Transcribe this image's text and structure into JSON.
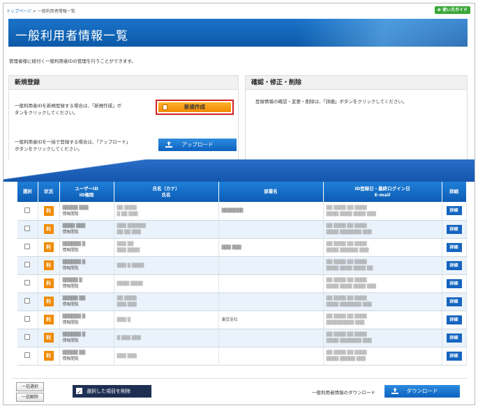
{
  "breadcrumb": {
    "home": "トップページ",
    "sep": " > ",
    "current": "一般利用者情報一覧"
  },
  "guide_button": "使い方ガイド",
  "page_title": "一般利用者情報一覧",
  "description": "管理者様に紐付く一般利用者IDの管理を行うことができます。",
  "register_panel": {
    "title": "新規登録",
    "text1_line1": "一般利用者IDを新規登録する場合は、「新規作成」ボ",
    "text1_line2": "タンをクリックしてください。",
    "new_button": "新規作成",
    "text2_line1": "一般利用者IDを一括で登録する場合は、「アップロード」",
    "text2_line2": "ボタンをクリックしてください。",
    "upload_button": "アップロード"
  },
  "edit_panel": {
    "title": "確認・修正・削除",
    "text": "登録情報の確認・変更・削除は、「詳細」ボタンをクリックしてください。"
  },
  "table": {
    "headers": {
      "select": "選択",
      "status": "状況",
      "user_id_1": "ユーザーID",
      "user_id_2": "ID権限",
      "name_1": "氏名（カナ）",
      "name_2": "氏名",
      "dept": "部署名",
      "date_1": "ID登録日・最終ログイン日",
      "date_2": "E-mail",
      "detail": "詳細"
    },
    "status_label": "利",
    "detail_label": "詳細",
    "rows": [
      {
        "uid": "▒▒▒▒▒ ▒▒▒",
        "role": "情報閲覧",
        "kana": "▒▒ ▒▒▒▒",
        "name": "▒ ▒▒ ▒▒▒",
        "dept": "▒▒▒▒▒▒▒",
        "date": "▒▒ ▒▒▒▒ ▒▒ ▒▒▒▒",
        "email": "▒▒▒▒ ▒▒▒▒ ▒▒▒▒ ▒▒▒"
      },
      {
        "uid": "▒▒▒▒ ▒▒▒",
        "role": "情報閲覧",
        "kana": "▒▒▒ ▒▒▒▒▒▒",
        "name": "▒▒ ▒▒ ▒▒▒",
        "dept": "",
        "date": "▒▒ ▒▒▒▒ ▒▒ ▒▒▒▒",
        "email": "▒▒▒▒ ▒▒▒▒▒▒▒ ▒▒▒"
      },
      {
        "uid": "▒▒▒▒▒▒ ▒",
        "role": "情報閲覧",
        "kana": "▒▒▒ ▒▒",
        "name": "▒▒▒ ▒▒▒▒",
        "dept": "▒▒▒ ▒▒▒",
        "date": "▒▒ ▒▒▒▒ ▒▒ ▒▒▒▒",
        "email": "▒▒▒▒ ▒▒▒▒▒▒ ▒▒▒"
      },
      {
        "uid": "▒▒▒▒▒▒ ▒",
        "role": "情報閲覧",
        "kana": "",
        "name": "▒▒▒ ▒ ▒▒▒▒",
        "dept": "",
        "date": "▒▒ ▒▒▒▒ ▒▒ ▒▒▒▒",
        "email": "▒▒▒▒ ▒▒▒▒ ▒▒▒▒ ▒▒"
      },
      {
        "uid": "▒▒▒▒▒ ▒",
        "role": "情報閲覧",
        "kana": "",
        "name": "▒▒▒▒ ▒▒▒▒",
        "dept": "",
        "date": "▒▒ ▒▒▒▒ ▒▒ ▒▒▒▒",
        "email": "▒▒▒▒ ▒▒▒▒ ▒▒▒▒ ▒▒▒"
      },
      {
        "uid": "▒▒▒▒▒ ▒▒",
        "role": "情報閲覧",
        "kana": "▒▒ ▒▒▒▒",
        "name": "▒▒▒ ▒▒▒",
        "dept": "",
        "date": "▒▒ ▒▒▒▒ ▒▒ ▒▒▒▒",
        "email": "▒▒▒▒ ▒▒▒▒▒▒▒ ▒▒▒"
      },
      {
        "uid": "▒▒▒▒▒▒ ▒",
        "role": "情報閲覧",
        "kana": "",
        "name": "▒▒▒ ▒",
        "dept": "東京支社",
        "date": "▒▒ ▒▒▒▒ ▒▒ ▒▒▒▒",
        "email": "▒▒▒▒▒▒▒▒▒ ▒▒▒"
      },
      {
        "uid": "▒▒▒▒▒▒ ▒",
        "role": "情報閲覧",
        "kana": "",
        "name": "▒ ▒▒▒ ▒▒▒",
        "dept": "",
        "date": "▒▒ ▒▒▒▒ ▒▒ ▒▒▒▒",
        "email": "▒▒▒▒ ▒▒▒▒▒▒▒ ▒▒▒"
      },
      {
        "uid": "▒▒▒▒▒ ▒▒",
        "role": "情報閲覧",
        "kana": "",
        "name": "▒▒▒ ▒▒▒",
        "dept": "",
        "date": "▒▒ ▒▒▒▒ ▒▒ ▒▒▒▒",
        "email": "▒▒▒▒ ▒▒▒▒▒ ▒▒▒"
      }
    ]
  },
  "footer": {
    "select_all": "一括選択",
    "deselect_all": "一括解除",
    "delete_button": "選択した項目を削除",
    "download_label": "一般利用者情報のダウンロード",
    "download_button": "ダウンロード"
  }
}
